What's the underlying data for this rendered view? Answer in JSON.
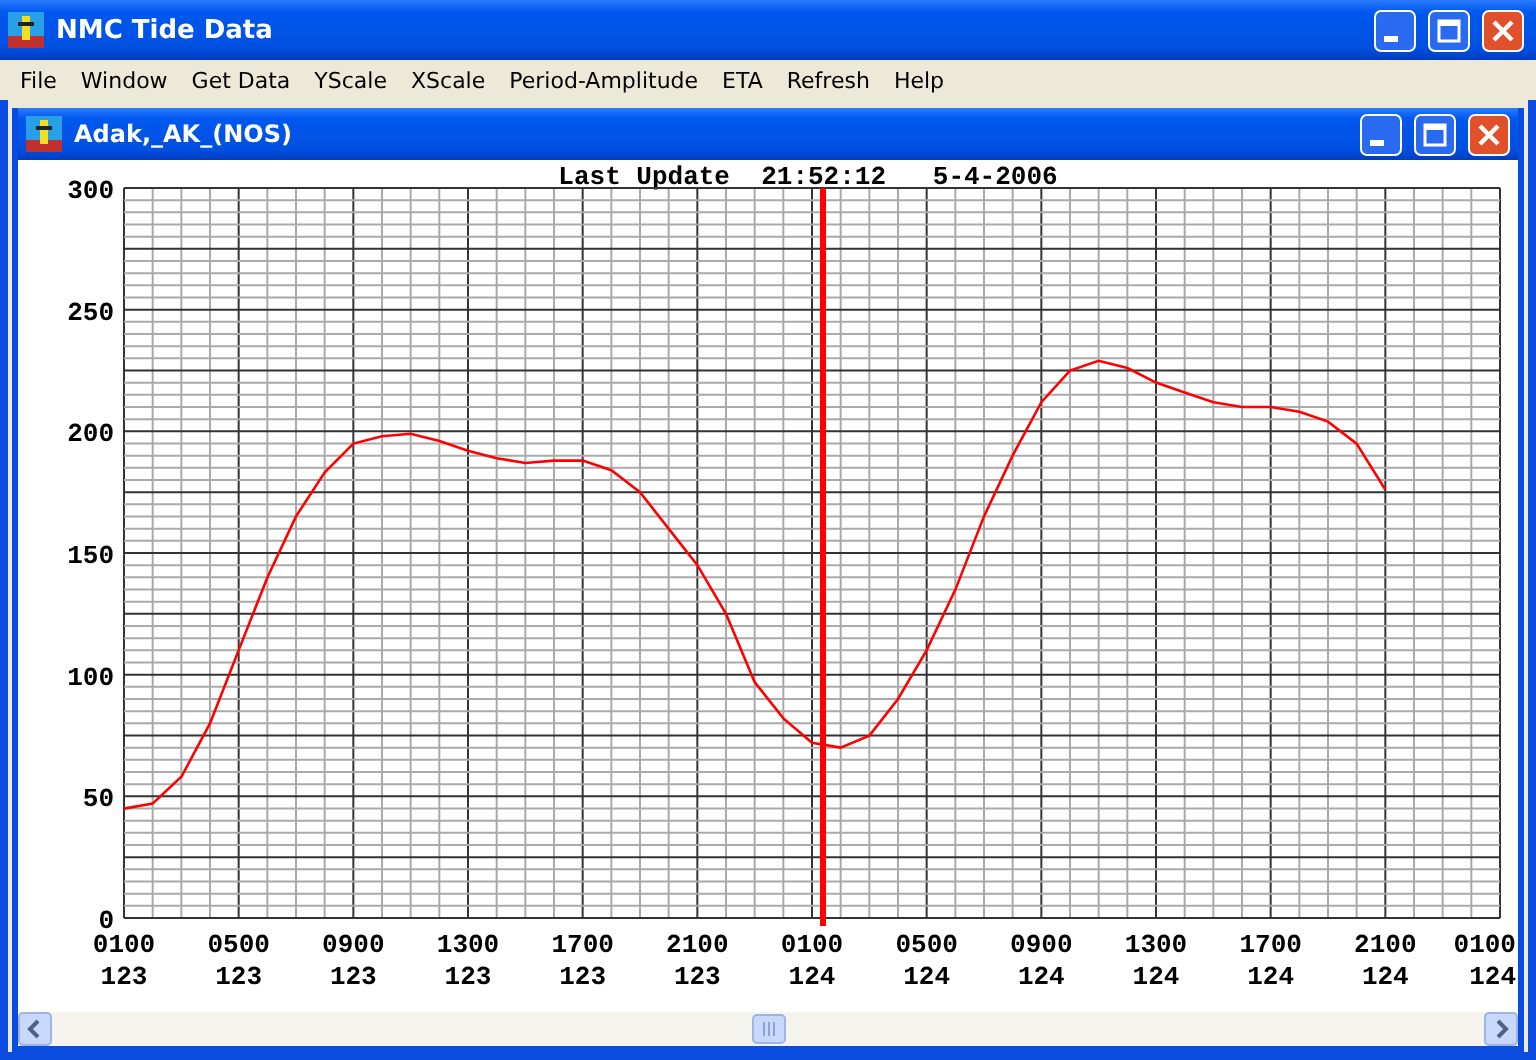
{
  "window": {
    "title": "NMC Tide Data"
  },
  "menu": [
    "File",
    "Window",
    "Get Data",
    "YScale",
    "XScale",
    "Period-Amplitude",
    "ETA",
    "Refresh",
    "Help"
  ],
  "child_window": {
    "title": "Adak,_AK_(NOS)",
    "chart_data": {
      "type": "line",
      "title": "Last Update  21:52:12   5-4-2006",
      "categories": [
        "0100\n123",
        null,
        null,
        null,
        "0500\n123",
        null,
        null,
        null,
        "0900\n123",
        null,
        null,
        null,
        "1300\n123",
        null,
        null,
        null,
        "1700\n123",
        null,
        null,
        null,
        "2100\n123",
        null,
        null,
        null,
        "0100\n124",
        null,
        null,
        null,
        "0500\n124",
        null,
        null,
        null,
        "0900\n124",
        null,
        null,
        null,
        "1300\n124",
        null,
        null,
        null,
        "1700\n124",
        null,
        null,
        null,
        "2100\n124",
        null,
        null,
        null,
        "0100\n124"
      ],
      "series": [
        {
          "color": "#ff0000",
          "values": [
            45,
            47,
            58,
            80,
            110,
            140,
            165,
            183,
            195,
            198,
            199,
            196,
            192,
            189,
            187,
            188,
            188,
            184,
            175,
            160,
            145,
            125,
            97,
            82,
            72,
            70,
            75,
            90,
            110,
            135,
            165,
            190,
            212,
            225,
            229,
            226,
            220,
            216,
            212,
            210,
            210,
            208,
            204,
            195,
            176,
            null,
            null,
            null,
            null
          ]
        }
      ],
      "ylim": [
        0,
        300
      ],
      "yticks": [
        0,
        50,
        100,
        150,
        200,
        250,
        300
      ],
      "grid": true
    }
  }
}
